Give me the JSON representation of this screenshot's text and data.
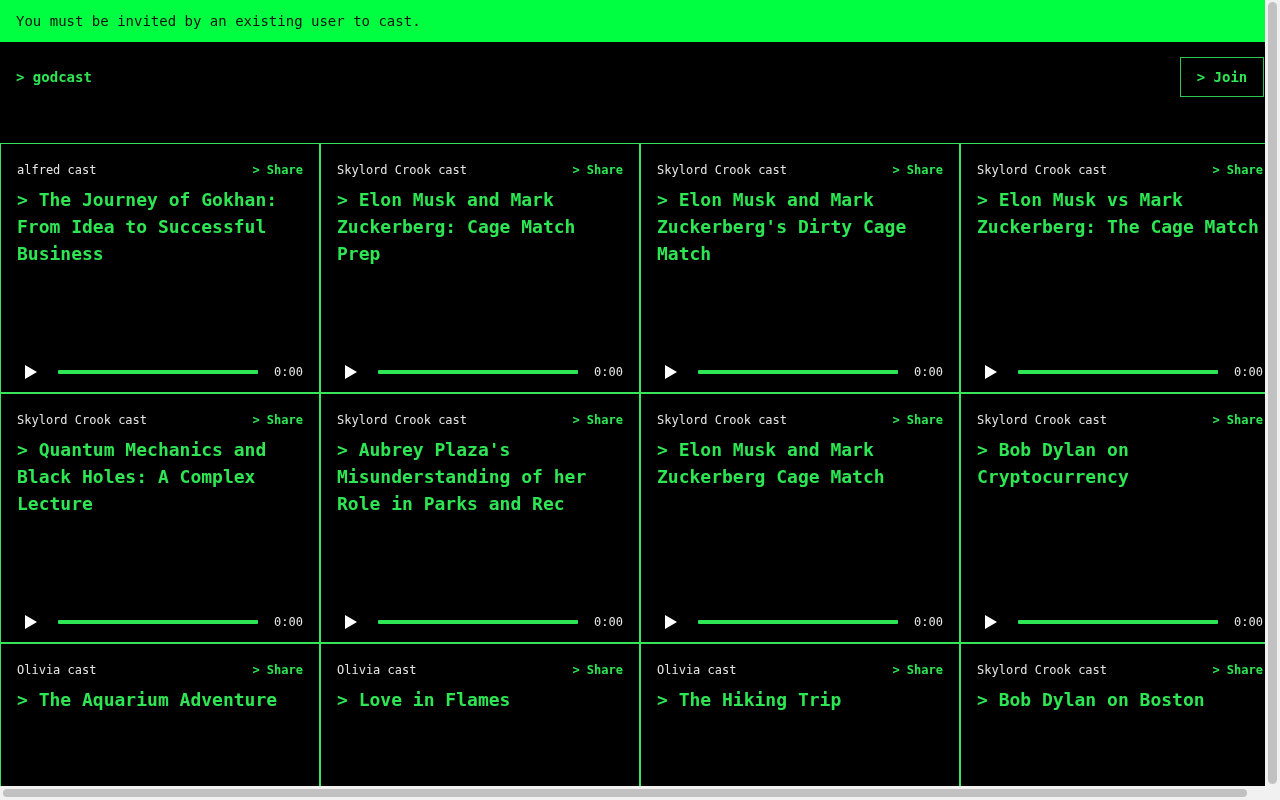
{
  "banner": {
    "text": "You must be invited by an existing user to cast."
  },
  "header": {
    "logo": "> godcast",
    "join_button": "> Join"
  },
  "casts": [
    {
      "author": "alfred cast",
      "share": "> Share",
      "title": "> The Journey of Gokhan: From Idea to Successful Business",
      "player": {
        "time": "0:00"
      }
    },
    {
      "author": "Skylord Crook cast",
      "share": "> Share",
      "title": "> Elon Musk and Mark Zuckerberg: Cage Match Prep",
      "player": {
        "time": "0:00"
      }
    },
    {
      "author": "Skylord Crook cast",
      "share": "> Share",
      "title": "> Elon Musk and Mark Zuckerberg's Dirty Cage Match",
      "player": {
        "time": "0:00"
      }
    },
    {
      "author": "Skylord Crook cast",
      "share": "> Share",
      "title": "> Elon Musk vs Mark Zuckerberg: The Cage Match",
      "player": {
        "time": "0:00"
      }
    },
    {
      "author": "Skylord Crook cast",
      "share": "> Share",
      "title": "> Quantum Mechanics and Black Holes: A Complex Lecture",
      "player": {
        "time": "0:00"
      }
    },
    {
      "author": "Skylord Crook cast",
      "share": "> Share",
      "title": "> Aubrey Plaza's Misunderstanding of her Role in Parks and Rec",
      "player": {
        "time": "0:00"
      }
    },
    {
      "author": "Skylord Crook cast",
      "share": "> Share",
      "title": "> Elon Musk and Mark Zuckerberg Cage Match",
      "player": {
        "time": "0:00"
      }
    },
    {
      "author": "Skylord Crook cast",
      "share": "> Share",
      "title": "> Bob Dylan on Cryptocurrency",
      "player": {
        "time": "0:00"
      }
    },
    {
      "author": "Olivia cast",
      "share": "> Share",
      "title": "> The Aquarium Adventure"
    },
    {
      "author": "Olivia cast",
      "share": "> Share",
      "title": "> Love in Flames"
    },
    {
      "author": "Olivia cast",
      "share": "> Share",
      "title": "> The Hiking Trip"
    },
    {
      "author": "Skylord Crook cast",
      "share": "> Share",
      "title": "> Bob Dylan on Boston"
    }
  ]
}
